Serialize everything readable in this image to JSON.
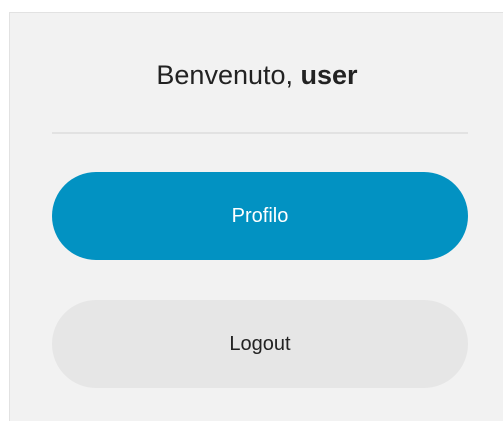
{
  "welcome": {
    "greeting": "Benvenuto, ",
    "username": "user"
  },
  "buttons": {
    "profile_label": "Profilo",
    "logout_label": "Logout"
  },
  "colors": {
    "primary": "#0292c2",
    "secondary": "#e6e6e6",
    "panel_background": "#f2f2f2",
    "text": "#222222"
  }
}
